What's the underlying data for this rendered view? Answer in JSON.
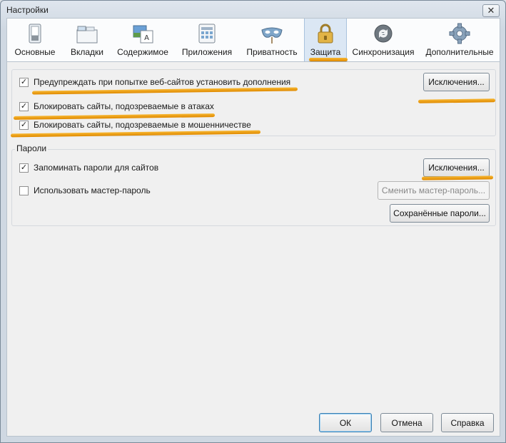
{
  "window": {
    "title": "Настройки",
    "close_glyph": "✕"
  },
  "tabs": [
    {
      "label": "Основные",
      "icon": "switch-icon"
    },
    {
      "label": "Вкладки",
      "icon": "tabs-icon"
    },
    {
      "label": "Содержимое",
      "icon": "content-icon"
    },
    {
      "label": "Приложения",
      "icon": "applications-icon"
    },
    {
      "label": "Приватность",
      "icon": "mask-icon"
    },
    {
      "label": "Защита",
      "icon": "lock-icon",
      "active": true
    },
    {
      "label": "Синхронизация",
      "icon": "sync-icon"
    },
    {
      "label": "Дополнительные",
      "icon": "gear-icon"
    }
  ],
  "security": {
    "warn_addons": {
      "label": "Предупреждать при попытке веб-сайтов установить дополнения",
      "checked": true
    },
    "exceptions_label": "Исключения...",
    "block_attack": {
      "label": "Блокировать сайты, подозреваемые в атаках",
      "checked": true
    },
    "block_fraud": {
      "label": "Блокировать сайты, подозреваемые в мошенничестве",
      "checked": true
    }
  },
  "passwords": {
    "title": "Пароли",
    "remember": {
      "label": "Запоминать пароли для сайтов",
      "checked": true
    },
    "exceptions_label": "Исключения...",
    "master": {
      "label": "Использовать мастер-пароль",
      "checked": false
    },
    "change_master_label": "Сменить мастер-пароль...",
    "saved_label": "Сохранённые пароли..."
  },
  "footer": {
    "ok": "ОК",
    "cancel": "Отмена",
    "help": "Справка"
  },
  "colors": {
    "highlight": "#f0a020",
    "active_tab": "#dbe7f4"
  }
}
